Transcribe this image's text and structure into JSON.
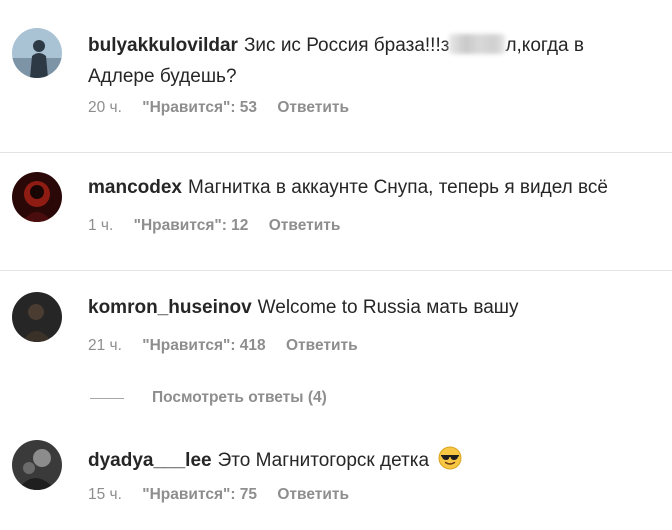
{
  "comments": [
    {
      "username": "bulyakkulovildar",
      "text_before": "Зис ис Россия браза!!!з",
      "text_after": "л,когда в Адлере будешь?",
      "time": "20 ч.",
      "likes": "\"Нравится\": 53",
      "reply": "Ответить",
      "avatar_colors": {
        "bg": "#9ab4c8",
        "fg": "#2d3a45"
      }
    },
    {
      "username": "mancodex",
      "text": "Магнитка в аккаунте Снупа, теперь я видел всё",
      "time": "1 ч.",
      "likes": "\"Нравится\": 12",
      "reply": "Ответить",
      "avatar_colors": {
        "bg": "#3a0f0f",
        "fg": "#c0392b"
      }
    },
    {
      "username": "komron_huseinov",
      "text": "Welcome to Russia мать вашу",
      "time": "21 ч.",
      "likes": "\"Нравится\": 418",
      "reply": "Ответить",
      "view_replies": "Посмотреть ответы (4)",
      "avatar_colors": {
        "bg": "#2b2b2b",
        "fg": "#5a4a3a"
      }
    },
    {
      "username": "dyadya___lee",
      "text": "Это Магнитогорск детка",
      "emoji": "sunglasses-emoji",
      "time": "15 ч.",
      "likes": "\"Нравится\": 75",
      "reply": "Ответить",
      "avatar_colors": {
        "bg": "#3c3c3c",
        "fg": "#9a9a9a"
      }
    }
  ]
}
